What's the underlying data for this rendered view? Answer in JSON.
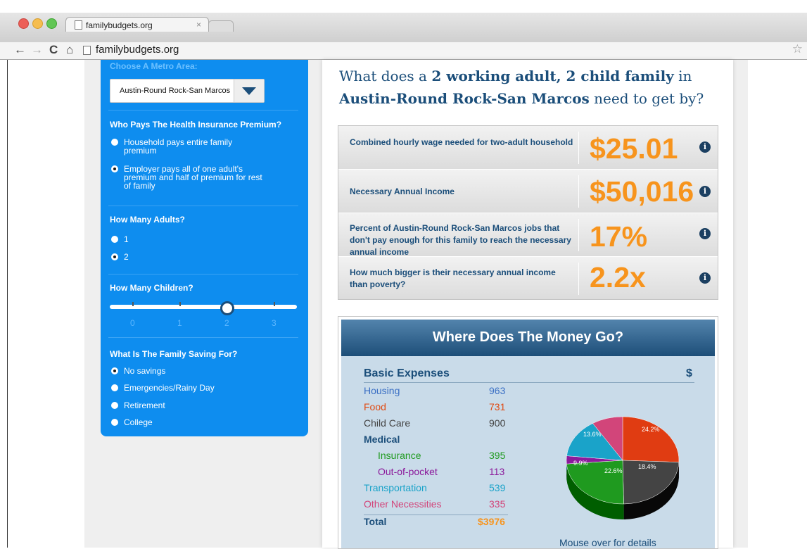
{
  "browser": {
    "tab_title": "familybudgets.org",
    "tab_close": "×",
    "url": "familybudgets.org",
    "nav": {
      "back": "←",
      "forward": "→",
      "reload": "C",
      "home": "⌂",
      "star": "☆"
    }
  },
  "sidebar": {
    "metro_label": "Choose A Metro Area:",
    "metro_value": "Austin-Round Rock-San Marcos",
    "health_title": "Who Pays The Health Insurance Premium?",
    "health_options": [
      {
        "line1": "Household pays entire family",
        "line2": "premium",
        "line3": "",
        "checked": false
      },
      {
        "line1": "Employer pays all of one adult's",
        "line2": "premium and half of premium for rest",
        "line3": "of family",
        "checked": true
      }
    ],
    "adults_title": "How Many Adults?",
    "adults_options": [
      {
        "label": "1",
        "checked": false
      },
      {
        "label": "2",
        "checked": true
      }
    ],
    "children_title": "How Many Children?",
    "children_scale": [
      "0",
      "1",
      "2",
      "3"
    ],
    "children_value": 2,
    "saving_title": "What Is The Family Saving For?",
    "saving_options": [
      {
        "label": "No savings",
        "checked": true
      },
      {
        "label": "Emergencies/Rainy Day",
        "checked": false
      },
      {
        "label": "Retirement",
        "checked": false
      },
      {
        "label": "College",
        "checked": false
      }
    ]
  },
  "headline": {
    "part1": "What does a ",
    "bold1": "2 working adult, 2 child family",
    "part2": " in",
    "bold2": "Austin-Round Rock-San Marcos",
    "part3": " need to get by?"
  },
  "stats": [
    {
      "label": "Combined hourly wage needed for two-adult household",
      "value": "$25.01"
    },
    {
      "label": "Necessary Annual Income",
      "value": "$50,016"
    },
    {
      "label": "Percent of Austin-Round Rock-San Marcos jobs that don't pay enough for this family to reach the necessary annual income",
      "value": "17%"
    },
    {
      "label": "How much bigger is their necessary annual income than poverty?",
      "value": "2.2x"
    }
  ],
  "info_glyph": "i",
  "money": {
    "title": "Where Does The Money Go?",
    "basic_expenses": "Basic Expenses",
    "dollar": "$",
    "expenses": [
      {
        "label": "Housing",
        "value": "963",
        "color": "#3a6fc4"
      },
      {
        "label": "Food",
        "value": "731",
        "color": "#e04a12"
      },
      {
        "label": "Child Care",
        "value": "900",
        "color": "#444444"
      },
      {
        "label": "Medical",
        "value": "",
        "color": "#1b4e7a"
      },
      {
        "label": "Insurance",
        "value": "395",
        "color": "#1f9a1f"
      },
      {
        "label": "Out-of-pocket",
        "value": "113",
        "color": "#8b1a9b"
      },
      {
        "label": "Transportation",
        "value": "539",
        "color": "#1aa3c9"
      },
      {
        "label": "Other Necessities",
        "value": "335",
        "color": "#d2457a"
      },
      {
        "label": "Total",
        "value": "$3976",
        "color": "#1b4e7a",
        "value_color": "#f7941d"
      }
    ],
    "pie_labels": [
      "24.2%",
      "18.4%",
      "22.6%",
      "9.9%",
      "13.6%"
    ],
    "mouse_note": "Mouse over for details"
  },
  "chart_data": {
    "type": "pie",
    "title": "",
    "slices": [
      {
        "label": "Housing",
        "value": 24.2,
        "color": "#e03c12"
      },
      {
        "label": "Child Care",
        "value": 22.6,
        "color": "#444444"
      },
      {
        "label": "Insurance",
        "value": 22.6,
        "color": "#1f9a1f"
      },
      {
        "label": "Out-of-pocket",
        "value": 2.8,
        "color": "#8b1a9b"
      },
      {
        "label": "Transportation",
        "value": 13.6,
        "color": "#1aa3c9"
      },
      {
        "label": "Other Necessities",
        "value": 8.4,
        "color": "#d2457a"
      }
    ]
  }
}
